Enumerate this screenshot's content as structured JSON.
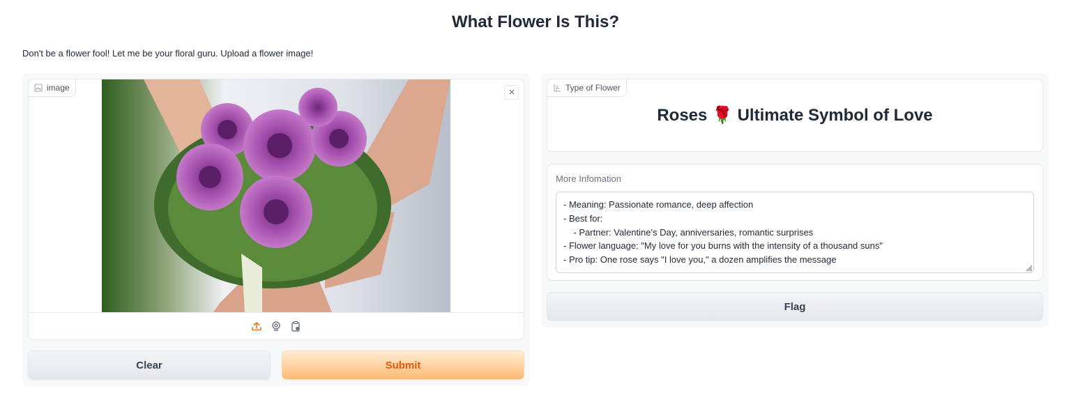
{
  "header": {
    "title": "What Flower Is This?",
    "description": "Don't be a flower fool! Let me be your floral guru. Upload a flower image!"
  },
  "input_panel": {
    "image_label": "image",
    "image_icon": "image-icon",
    "source_icons": [
      "upload-icon",
      "webcam-icon",
      "clipboard-icon"
    ],
    "clear_label": "Clear",
    "submit_label": "Submit",
    "accent_color": "#ea580c"
  },
  "output_panel": {
    "type_label": "Type of Flower",
    "type_value": "Roses 🌹 Ultimate Symbol of Love",
    "info_label": "More Infomation",
    "info_text": "- Meaning: Passionate romance, deep affection\n- Best for:\n    - Partner: Valentine's Day, anniversaries, romantic surprises\n- Flower language: \"My love for you burns with the intensity of a thousand suns\"\n- Pro tip: One rose says \"I love you,\" a dozen amplifies the message",
    "flag_label": "Flag"
  }
}
